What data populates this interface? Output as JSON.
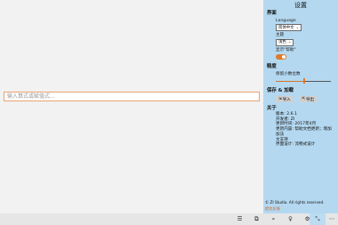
{
  "main": {
    "expression_input": {
      "value": "",
      "placeholder": "输入算式或赋值式..."
    }
  },
  "settings": {
    "title": "设置",
    "interface": {
      "heading": "界面",
      "language_label": "Language",
      "language_value": "简体中文",
      "theme_label": "主题",
      "theme_value": "浅色",
      "help_label": "显示\"帮助\"",
      "help_enabled": true
    },
    "precision": {
      "heading": "精度",
      "decimals_label": "保留小数位数",
      "slider_fraction": 0.52
    },
    "save_load": {
      "heading": "保存 & 加载",
      "import_label": "导入",
      "export_label": "导出"
    },
    "about": {
      "heading": "关于",
      "lines": [
        "版本: 2.6.1",
        "开发者: ZI",
        "更新时间: 2017年4月",
        "更新内容: 帮助文档更新；增加加法",
        "文支持",
        "界面设计: 流畅式设计"
      ]
    },
    "copyright": "© ZI Studio. All rights reserved.",
    "feedback": "提交反馈"
  },
  "bottom_bar": {
    "icons": [
      "list-icon",
      "copy-icon",
      "search-icon",
      "lightbulb-icon",
      "settings-icon",
      "resize-icon",
      "more-icon"
    ],
    "glyphs": [
      "☰",
      "⧉",
      "⌕",
      "♀",
      "⚙",
      "⤡",
      "⋯"
    ],
    "active_index": 5
  },
  "colors": {
    "accent": "#e07a2c",
    "panel": "#b4d8f0",
    "background": "#f2f2f2"
  }
}
